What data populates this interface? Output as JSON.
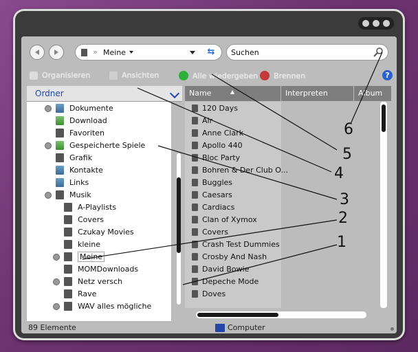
{
  "address": {
    "location": "Meine"
  },
  "search": {
    "placeholder": "Suchen"
  },
  "commands": {
    "organize": "Organisieren",
    "views": "Ansichten",
    "play_all": "Alle wiedergeben",
    "burn": "Brennen"
  },
  "left_panel": {
    "header": "Ordner"
  },
  "tree": [
    {
      "label": "Dokumente",
      "icon": "documents-folder-icon"
    },
    {
      "label": "Download",
      "icon": "download-folder-icon"
    },
    {
      "label": "Favoriten",
      "icon": "favorites-folder-icon"
    },
    {
      "label": "Gespeicherte Spiele",
      "icon": "saved-games-folder-icon"
    },
    {
      "label": "Grafik",
      "icon": "folder-icon"
    },
    {
      "label": "Kontakte",
      "icon": "contacts-folder-icon"
    },
    {
      "label": "Links",
      "icon": "links-folder-icon"
    },
    {
      "label": "Musik",
      "icon": "music-folder-icon"
    },
    {
      "label": "A-Playlists",
      "icon": "folder-icon"
    },
    {
      "label": "Covers",
      "icon": "folder-icon"
    },
    {
      "label": "Czukay Movies",
      "icon": "folder-icon"
    },
    {
      "label": "kleine",
      "icon": "folder-icon"
    },
    {
      "label": "Meine",
      "icon": "folder-icon",
      "selected": true
    },
    {
      "label": "MOMDownloads",
      "icon": "folder-icon"
    },
    {
      "label": "Netz versch",
      "icon": "folder-icon"
    },
    {
      "label": "Rave",
      "icon": "folder-icon"
    },
    {
      "label": "WAV alles mögliche",
      "icon": "folder-icon"
    }
  ],
  "columns": {
    "name": "Name",
    "artists": "Interpreten",
    "album": "Album"
  },
  "files": [
    "120 Days",
    "Air",
    "Anne Clark",
    "Apollo 440",
    "Bloc Party",
    "Bohren & Der Club O...",
    "Buggles",
    "Caesars",
    "Cardiacs",
    "Clan of Xymox",
    "Covers",
    "Crash Test Dummies",
    "Crosby And Nash",
    "David Bowie",
    "Depeche Mode",
    "Doves"
  ],
  "status": {
    "count": "89 Elemente",
    "location": "Computer"
  },
  "callouts": [
    "1",
    "2",
    "3",
    "4",
    "5",
    "6"
  ],
  "colors": {
    "accent": "#2346a8",
    "background": "#6d3270",
    "window_frame": "#3b3b3b"
  }
}
